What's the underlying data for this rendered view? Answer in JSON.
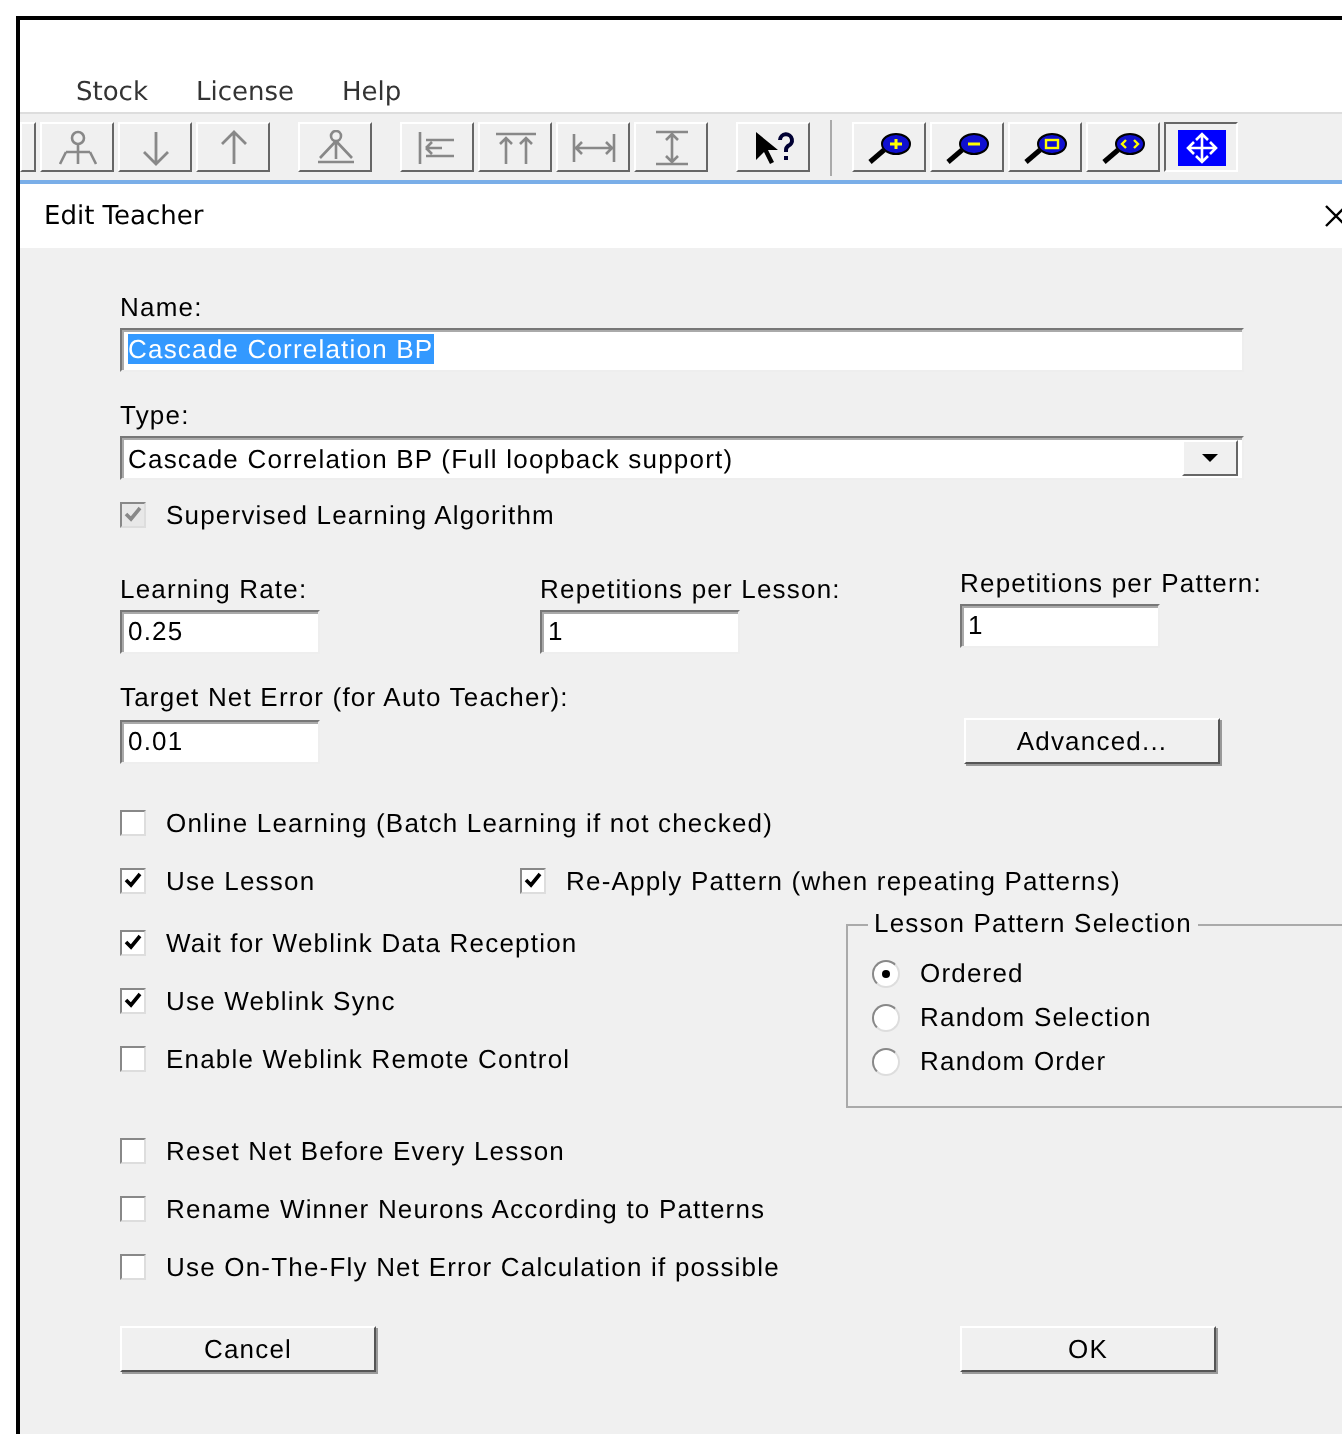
{
  "menu": [
    "Stock",
    "License",
    "Help"
  ],
  "toolbar_groups": [
    {
      "tools": [
        {
          "kind": "stub",
          "selected": false
        },
        {
          "kind": "node",
          "selected": false
        },
        {
          "kind": "down",
          "selected": false
        },
        {
          "kind": "up",
          "selected": false
        }
      ]
    },
    {
      "tools": [
        {
          "kind": "tree",
          "selected": false
        }
      ]
    },
    {
      "tools": [
        {
          "kind": "align-left",
          "selected": false
        },
        {
          "kind": "align-top",
          "selected": false
        },
        {
          "kind": "width",
          "selected": false
        },
        {
          "kind": "height",
          "selected": false
        }
      ]
    },
    {
      "tools": [
        {
          "kind": "help",
          "selected": false
        }
      ]
    },
    {
      "tools": [
        {
          "kind": "zoom-in",
          "selected": false
        },
        {
          "kind": "zoom-out",
          "selected": false
        },
        {
          "kind": "zoom-fit",
          "selected": false
        },
        {
          "kind": "zoom-width",
          "selected": false
        },
        {
          "kind": "move",
          "selected": true
        }
      ]
    }
  ],
  "dialog": {
    "title": "Edit Teacher",
    "name": {
      "label": "Name:",
      "value": "Cascade Correlation BP",
      "value_selected": true
    },
    "type": {
      "label": "Type:",
      "value": "Cascade Correlation BP (Full loopback support)"
    },
    "supervised": {
      "label": "Supervised Learning Algorithm",
      "checked": true,
      "disabled": true
    },
    "fields": [
      {
        "label": "Learning Rate:",
        "value": "0.25"
      },
      {
        "label": "Repetitions per Lesson:",
        "value": "1"
      },
      {
        "label": "Repetitions per Pattern:",
        "value": "1"
      }
    ],
    "target": {
      "label": "Target Net Error (for Auto Teacher):",
      "value": "0.01"
    },
    "advanced_button": "Advanced...",
    "options_top": [
      {
        "label": "Online Learning (Batch Learning if not checked)",
        "checked": false
      }
    ],
    "lesson_row": [
      {
        "label": "Use Lesson",
        "checked": true
      },
      {
        "label": "Re-Apply Pattern (when repeating Patterns)",
        "checked": true
      }
    ],
    "options_side": [
      {
        "label": "Wait for Weblink Data Reception",
        "checked": true
      },
      {
        "label": "Use Weblink Sync",
        "checked": true
      },
      {
        "label": "Enable Weblink Remote Control",
        "checked": false
      }
    ],
    "pattern_selection": {
      "title": "Lesson Pattern Selection",
      "options": [
        {
          "label": "Ordered",
          "selected": true
        },
        {
          "label": "Random Selection",
          "selected": false
        },
        {
          "label": "Random Order",
          "selected": false
        }
      ]
    },
    "options_bottom": [
      {
        "label": "Reset Net Before Every Lesson",
        "checked": false
      },
      {
        "label": "Rename Winner Neurons According to Patterns",
        "checked": false
      },
      {
        "label": "Use On-The-Fly Net Error Calculation if possible",
        "checked": false
      }
    ],
    "buttons": [
      "Cancel",
      "OK"
    ]
  }
}
